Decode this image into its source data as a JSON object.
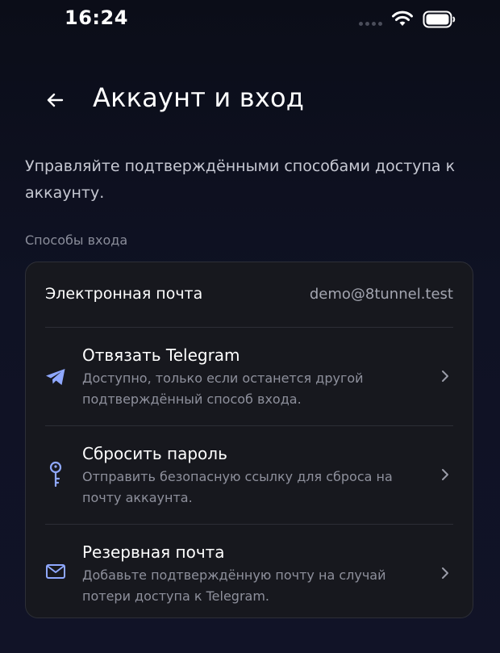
{
  "status_bar": {
    "time": "16:24"
  },
  "header": {
    "title": "Аккаунт и вход"
  },
  "description": "Управляйте подтверждёнными способами доступа к аккаунту.",
  "section": {
    "label": "Способы входа"
  },
  "email": {
    "label": "Электронная почта",
    "value": "demo@8tunnel.test"
  },
  "actions": [
    {
      "icon": "telegram-icon",
      "title": "Отвязать Telegram",
      "subtitle": "Доступно, только если останется другой подтверждённый способ входа."
    },
    {
      "icon": "key-icon",
      "title": "Сбросить пароль",
      "subtitle": "Отправить безопасную ссылку для сброса на почту аккаунта."
    },
    {
      "icon": "mail-icon",
      "title": "Резервная почта",
      "subtitle": "Добавьте подтверждённую почту на случай потери доступа к Telegram."
    }
  ],
  "colors": {
    "accent": "#8fa8ff",
    "card_bg": "#17181e",
    "muted_text": "#8e909c"
  }
}
